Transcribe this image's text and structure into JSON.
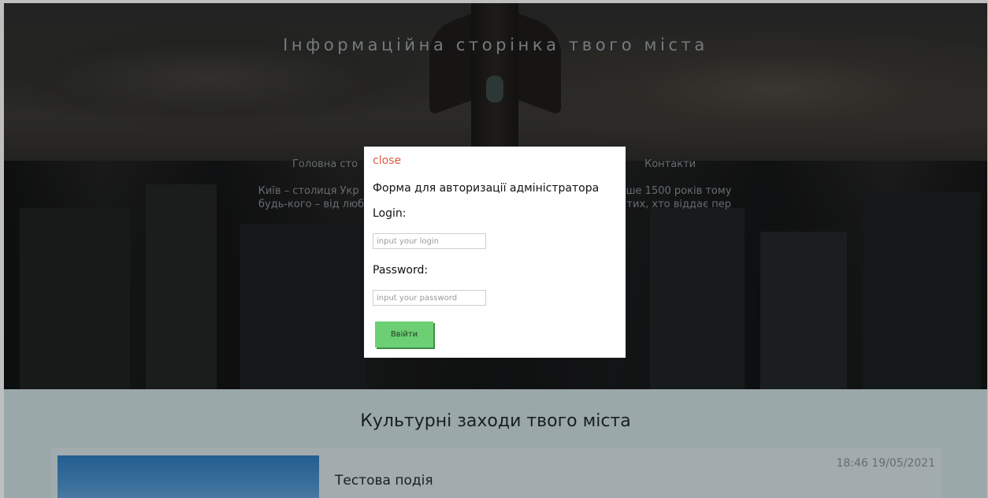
{
  "header": {
    "site_title": "Інформаційна сторінка твого міста",
    "nav": {
      "home": "Головна сто",
      "contacts": "Контакти"
    },
    "intro_text": "Київ – столиця Укр                                                        ване щонайменше 1500 років тому                                                      будь-кого – від любителів приро                                                      до тих, хто віддає пер                                                          нку."
  },
  "login_modal": {
    "close_label": "close",
    "title": "Форма для авторизації адміністратора",
    "login_label": "Login:",
    "login_placeholder": "input your login",
    "password_label": "Password:",
    "password_placeholder": "input your password",
    "submit_label": "Ввійти"
  },
  "events_section": {
    "title": "Культурні заходи твого міста",
    "events": [
      {
        "title": "Тестова подія",
        "datetime": "18:46 19/05/2021"
      }
    ]
  },
  "colors": {
    "close_link": "#e05a3c",
    "submit_button": "#6ccf74",
    "page_background": "#cfe0e2"
  }
}
